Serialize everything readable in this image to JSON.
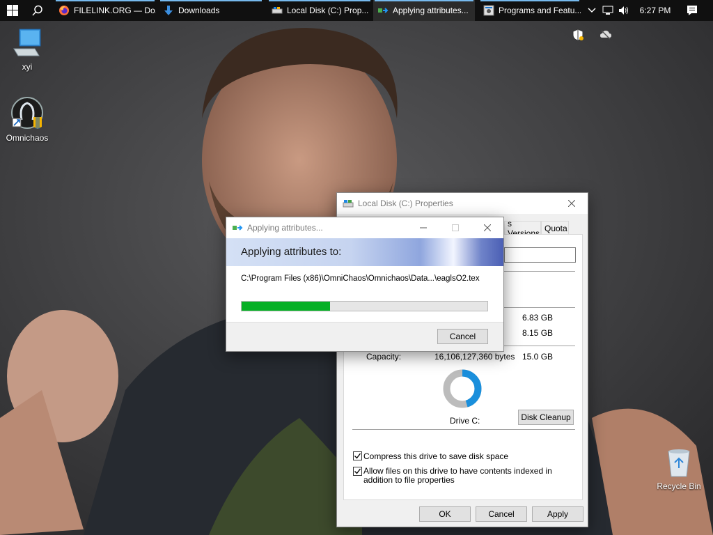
{
  "taskbar": {
    "apps": [
      {
        "label": "FILELINK.ORG — Do..."
      },
      {
        "label": "Downloads"
      },
      {
        "label": "Local Disk (C:) Prop..."
      },
      {
        "label": "Applying attributes..."
      },
      {
        "label": "Programs and Featu..."
      }
    ],
    "time": "6:27 PM"
  },
  "desktop": {
    "icons": [
      {
        "label": "xyi"
      },
      {
        "label": "Omnichaos"
      },
      {
        "label": "Recycle Bin"
      }
    ]
  },
  "properties": {
    "title": "Local Disk (C:) Properties",
    "tabs": {
      "previous_versions": "s Versions",
      "quota": "Quota"
    },
    "used_space": "6.83 GB",
    "free_space": "8.15 GB",
    "capacity_label": "Capacity:",
    "capacity_bytes": "16,106,127,360 bytes",
    "capacity_gb": "15.0 GB",
    "drive_label": "Drive C:",
    "disk_cleanup": "Disk Cleanup",
    "compress_label": "Compress this drive to save disk space",
    "compress_checked": true,
    "index_label": "Allow files on this drive to have contents indexed in addition to file properties",
    "index_checked": true,
    "used_fraction": 0.455,
    "ok": "OK",
    "cancel": "Cancel",
    "apply": "Apply"
  },
  "applying": {
    "title": "Applying attributes...",
    "banner": "Applying attributes to:",
    "path": "C:\\Program Files (x86)\\OmniChaos\\Omnichaos\\Data...\\eaglsO2.tex",
    "progress": 0.36,
    "cancel": "Cancel"
  },
  "colors": {
    "progress": "#06b025",
    "used": "#1a8fdc",
    "free": "#bcbcbc",
    "accent": "#0078d7"
  }
}
